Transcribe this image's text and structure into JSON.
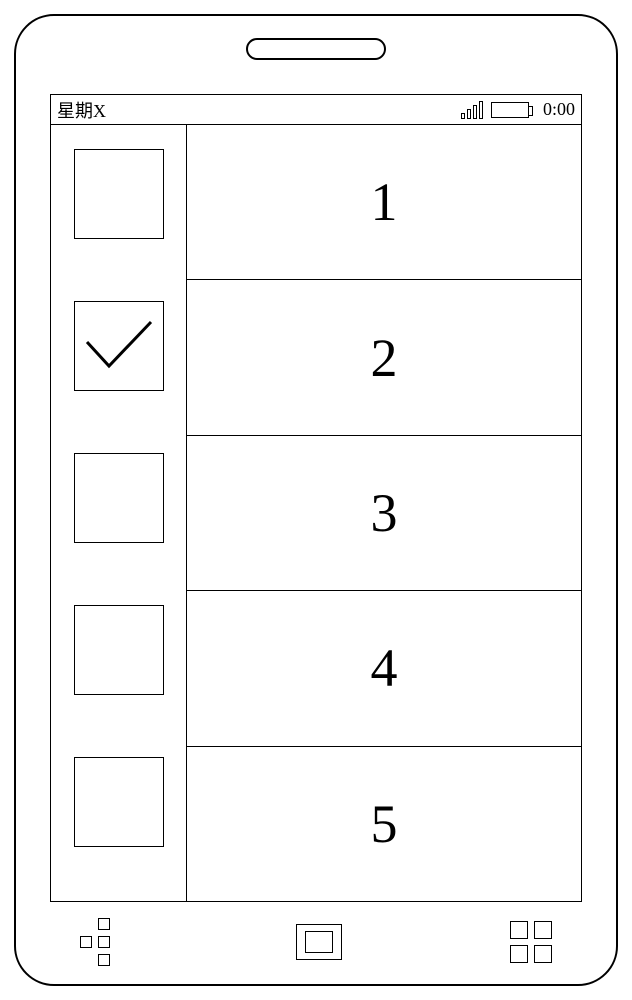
{
  "status": {
    "day_label": "星期X",
    "time": "0:00"
  },
  "sidebar": {
    "items": [
      {
        "checked": false
      },
      {
        "checked": true
      },
      {
        "checked": false
      },
      {
        "checked": false
      },
      {
        "checked": false
      }
    ]
  },
  "list": {
    "rows": [
      {
        "label": "1"
      },
      {
        "label": "2"
      },
      {
        "label": "3"
      },
      {
        "label": "4"
      },
      {
        "label": "5"
      }
    ]
  }
}
